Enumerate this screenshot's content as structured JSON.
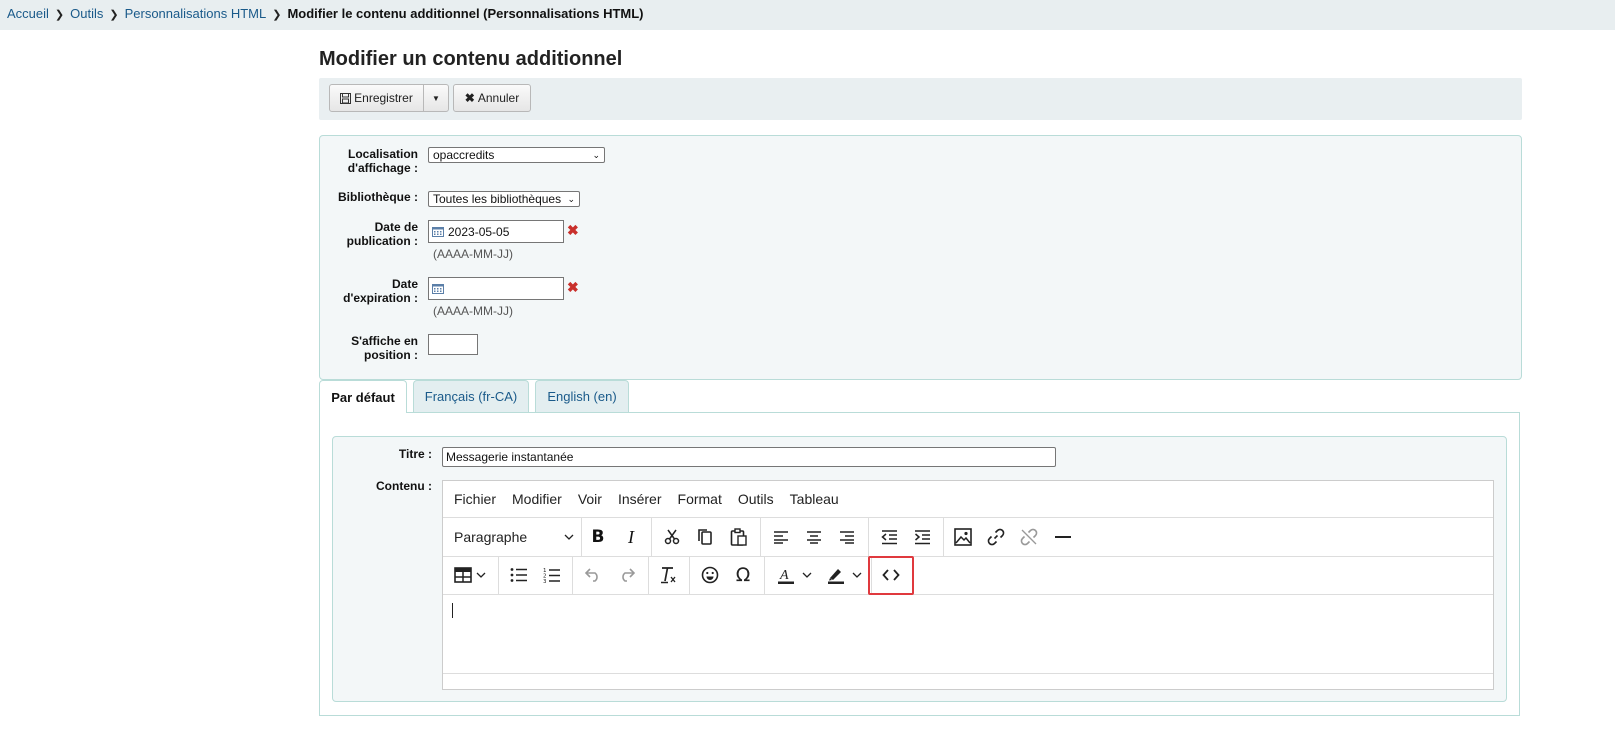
{
  "breadcrumb": {
    "home": "Accueil",
    "tools": "Outils",
    "html_custom": "Personnalisations HTML",
    "current": "Modifier le contenu additionnel (Personnalisations HTML)"
  },
  "page_title": "Modifier un contenu additionnel",
  "toolbar": {
    "save_label": "Enregistrer",
    "cancel_label": "Annuler"
  },
  "form": {
    "location_label_1": "Localisation",
    "location_label_2": "d'affichage :",
    "location_value": "opaccredits",
    "library_label": "Bibliothèque :",
    "library_value": "Toutes les bibliothèques",
    "pub_label_1": "Date de",
    "pub_label_2": "publication :",
    "pub_value": "2023-05-05",
    "pub_hint": "(AAAA-MM-JJ)",
    "exp_label_1": "Date",
    "exp_label_2": "d'expiration :",
    "exp_value": "",
    "exp_hint": "(AAAA-MM-JJ)",
    "pos_label_1": "S'affiche en",
    "pos_label_2": "position :",
    "pos_value": ""
  },
  "tabs": [
    {
      "label": "Par défaut"
    },
    {
      "label": "Français (fr-CA)"
    },
    {
      "label": "English (en)"
    }
  ],
  "content": {
    "title_label": "Titre :",
    "title_value": "Messagerie instantanée",
    "content_label": "Contenu :"
  },
  "editor": {
    "menus": [
      "Fichier",
      "Modifier",
      "Voir",
      "Insérer",
      "Format",
      "Outils",
      "Tableau"
    ],
    "block_format": "Paragraphe"
  },
  "colors": {
    "link": "#1a5a8a",
    "accent_border": "#b9dcd8",
    "highlight": "#e0393e",
    "remove": "#c9302c"
  }
}
